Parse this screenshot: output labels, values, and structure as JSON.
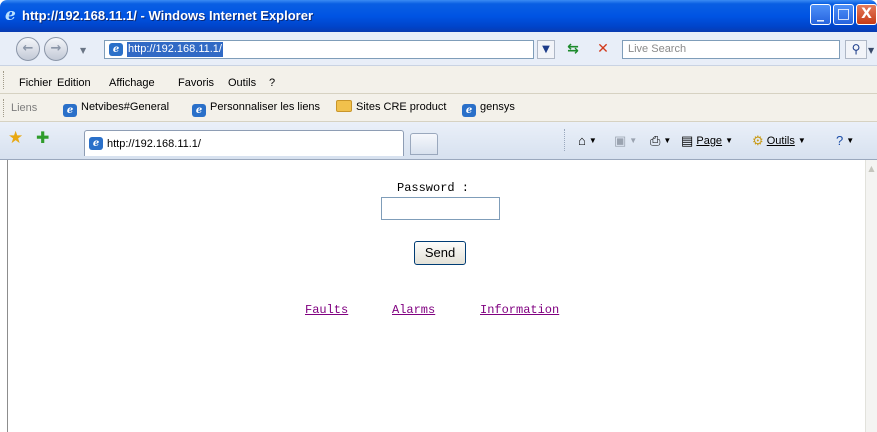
{
  "window": {
    "title": "http://192.168.11.1/ - Windows Internet Explorer",
    "controls": {
      "minimize": "_",
      "maximize": "□",
      "close": "X"
    }
  },
  "address_bar": {
    "url": "http://192.168.11.1/",
    "search_placeholder": "Live Search",
    "back_icon": "back-arrow-icon",
    "forward_icon": "forward-arrow-icon"
  },
  "menu": {
    "items": [
      "Fichier",
      "Edition",
      "Affichage",
      "Favoris",
      "Outils",
      "?"
    ]
  },
  "links_bar": {
    "label": "Liens",
    "items": [
      "Netvibes#General",
      "Personnaliser les liens",
      "Sites CRE product",
      "gensys"
    ]
  },
  "tab": {
    "title": "http://192.168.11.1/"
  },
  "command_bar": {
    "page_label": "Page",
    "tools_label": "Outils"
  },
  "page": {
    "password_label": "Password :",
    "password_value": "",
    "send_label": "Send",
    "links": [
      "Faults",
      "Alarms",
      "Information"
    ],
    "link_color": "#800080"
  },
  "colors": {
    "titlebar": "#0054e3",
    "selection": "#316ac5"
  }
}
